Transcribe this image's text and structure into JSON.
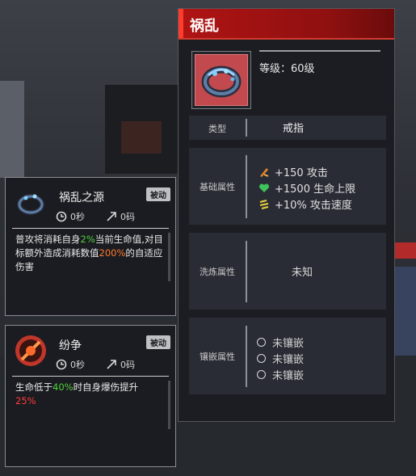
{
  "item": {
    "name": "祸乱",
    "level": "等级：60级",
    "type_label": "类型",
    "type_value": "戒指",
    "base_label": "基础属性",
    "base_stats": [
      {
        "icon": "attack-icon",
        "text": "+150 攻击"
      },
      {
        "icon": "heart-icon",
        "text": "+1500 生命上限"
      },
      {
        "icon": "attack-speed-icon",
        "text": "+10% 攻击速度"
      }
    ],
    "refine_label": "洗炼属性",
    "refine_value": "未知",
    "socket_label": "镶嵌属性",
    "sockets": [
      "未镶嵌",
      "未镶嵌",
      "未镶嵌"
    ]
  },
  "skills": [
    {
      "name": "祸乱之源",
      "badge": "被动",
      "cooldown": "0秒",
      "cost": "0码",
      "desc": [
        "普攻将消耗自身",
        "2%",
        "当前生命值,对目标额外造成消耗数值",
        "200%",
        "的自适应伤害"
      ]
    },
    {
      "name": "纷争",
      "badge": "被动",
      "cooldown": "0秒",
      "cost": "0码",
      "desc": [
        "生命低于",
        "40%",
        "时自身爆伤提升",
        "25%"
      ]
    }
  ],
  "colors": {
    "header_red": "#b01414",
    "highlight_green": "#4fd03a",
    "highlight_orange": "#ff7a2e",
    "highlight_red": "#ff3b3b"
  }
}
